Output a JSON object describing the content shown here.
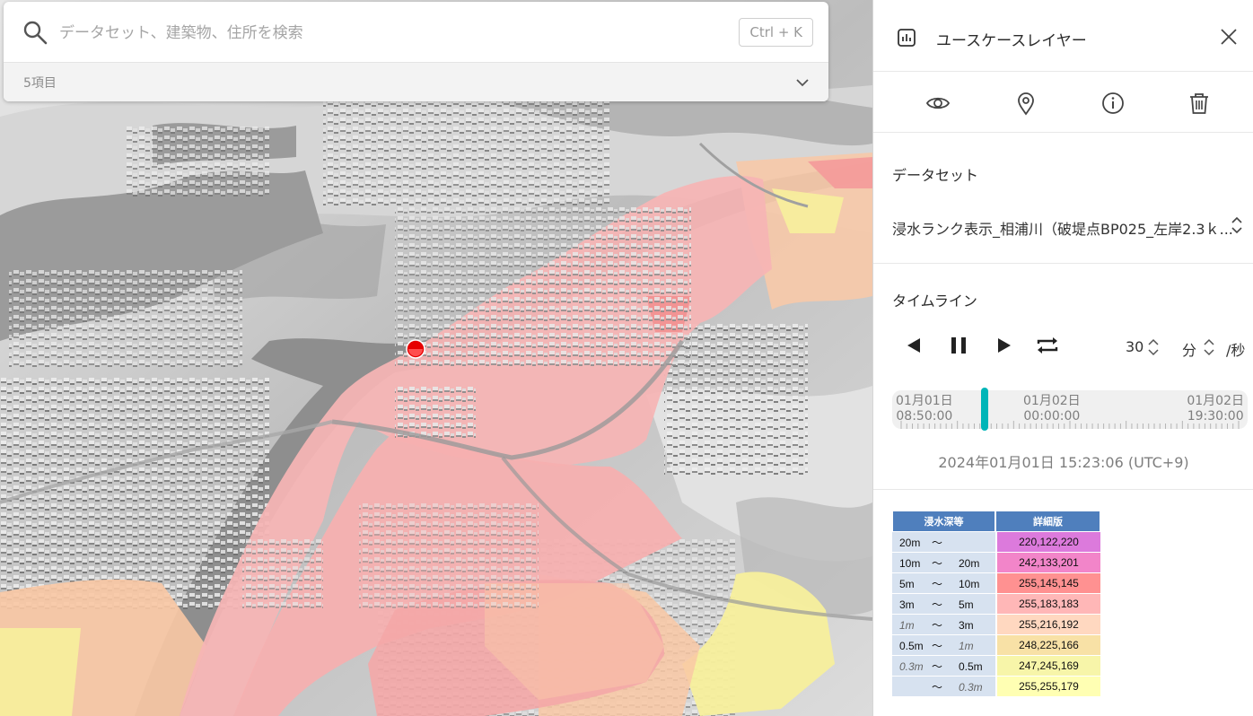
{
  "search": {
    "placeholder": "データセット、建築物、住所を検索",
    "shortcut": "Ctrl + K",
    "count": "5項目"
  },
  "panel": {
    "title": "ユースケースレイヤー",
    "dataset_label": "データセット",
    "dataset_value": "浸水ランク表示_相浦川（破堤点BP025_左岸2.3ｋ...",
    "timeline_label": "タイムライン",
    "speed_value": "30",
    "speed_unit": "分",
    "speed_suffix": "/秒",
    "timeline_start_date": "01月01日",
    "timeline_start_time": "08:50:00",
    "timeline_mid_date": "01月02日",
    "timeline_mid_time": "00:00:00",
    "timeline_end_date": "01月02日",
    "timeline_end_time": "19:30:00",
    "timeline_position": 0.247,
    "current_time": "2024年01月01日 15:23:06 (UTC+9)",
    "accent_color": "#00b5b8"
  },
  "legend": {
    "col1": "浸水深等",
    "col2": "詳細版",
    "rows": [
      {
        "from": "20m",
        "sep": "～",
        "to": "",
        "value": "220,122,220",
        "color": "#dc7adc",
        "from_italic": false,
        "to_italic": false
      },
      {
        "from": "10m",
        "sep": "～",
        "to": "20m",
        "value": "242,133,201",
        "color": "#f285c9",
        "from_italic": false,
        "to_italic": false
      },
      {
        "from": "5m",
        "sep": "～",
        "to": "10m",
        "value": "255,145,145",
        "color": "#ff9191",
        "from_italic": false,
        "to_italic": false
      },
      {
        "from": "3m",
        "sep": "～",
        "to": "5m",
        "value": "255,183,183",
        "color": "#ffb7b7",
        "from_italic": false,
        "to_italic": false
      },
      {
        "from": "1m",
        "sep": "～",
        "to": "3m",
        "value": "255,216,192",
        "color": "#ffd8c0",
        "from_italic": true,
        "to_italic": false
      },
      {
        "from": "0.5m",
        "sep": "～",
        "to": "1m",
        "value": "248,225,166",
        "color": "#f8e1a6",
        "from_italic": false,
        "to_italic": true
      },
      {
        "from": "0.3m",
        "sep": "～",
        "to": "0.5m",
        "value": "247,245,169",
        "color": "#f7f5a9",
        "from_italic": true,
        "to_italic": false
      },
      {
        "from": "",
        "sep": "～",
        "to": "0.3m",
        "value": "255,255,179",
        "color": "#ffffb3",
        "from_italic": false,
        "to_italic": true
      }
    ]
  },
  "icons": {
    "search": "search-icon",
    "chevron": "chevron-down-icon",
    "layer": "chart-bar-icon",
    "close": "close-icon",
    "visibility": "eye-icon",
    "location": "map-pin-icon",
    "info": "info-icon",
    "delete": "trash-icon",
    "prev": "play-reverse-icon",
    "pause": "pause-icon",
    "next": "play-icon",
    "loop": "repeat-icon"
  }
}
